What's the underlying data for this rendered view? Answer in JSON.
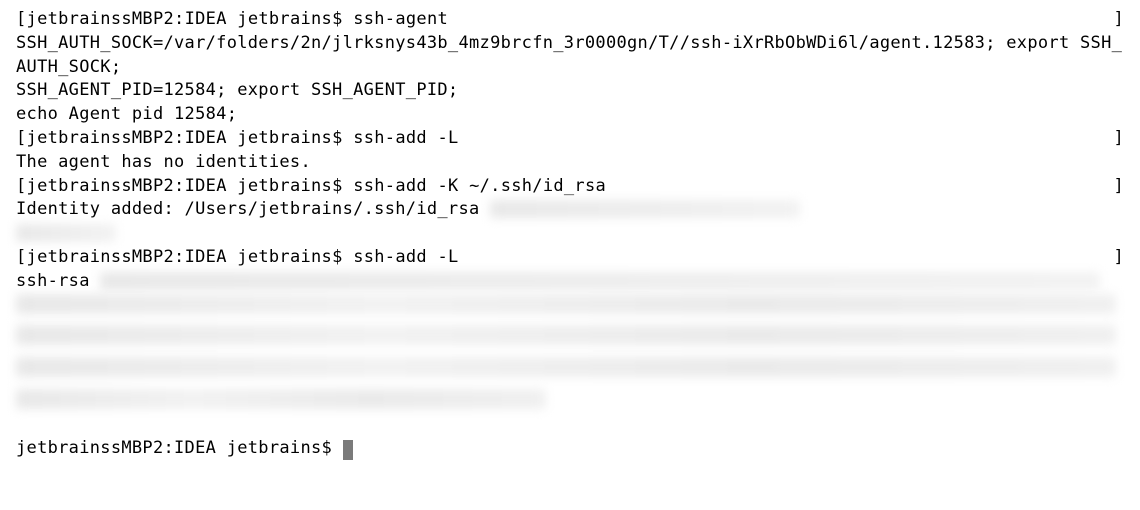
{
  "terminal": {
    "host": "jetbrainssMBP2",
    "cwd": "IDEA",
    "user": "jetbrains",
    "prompt_char": "$",
    "right_bracket": "]",
    "session": [
      {
        "command": "ssh-agent",
        "output_lines": [
          "SSH_AUTH_SOCK=/var/folders/2n/jlrksnys43b_4mz9brcfn_3r0000gn/T//ssh-iXrRbObWDi6l/agent.12583; export SSH_AUTH_SOCK;",
          "SSH_AGENT_PID=12584; export SSH_AGENT_PID;",
          "echo Agent pid 12584;"
        ]
      },
      {
        "command": "ssh-add -L",
        "output_lines": [
          "The agent has no identities."
        ]
      },
      {
        "command": "ssh-add -K ~/.ssh/id_rsa",
        "output_lines": [
          "Identity added: /Users/jetbrains/.ssh/id_rsa"
        ],
        "redacted_after": true
      },
      {
        "command": "ssh-add -L",
        "output_lines": [
          "ssh-rsa"
        ],
        "redacted_block": true
      }
    ],
    "final_prompt_no_bracket": "jetbrainssMBP2:IDEA jetbrains$ "
  }
}
